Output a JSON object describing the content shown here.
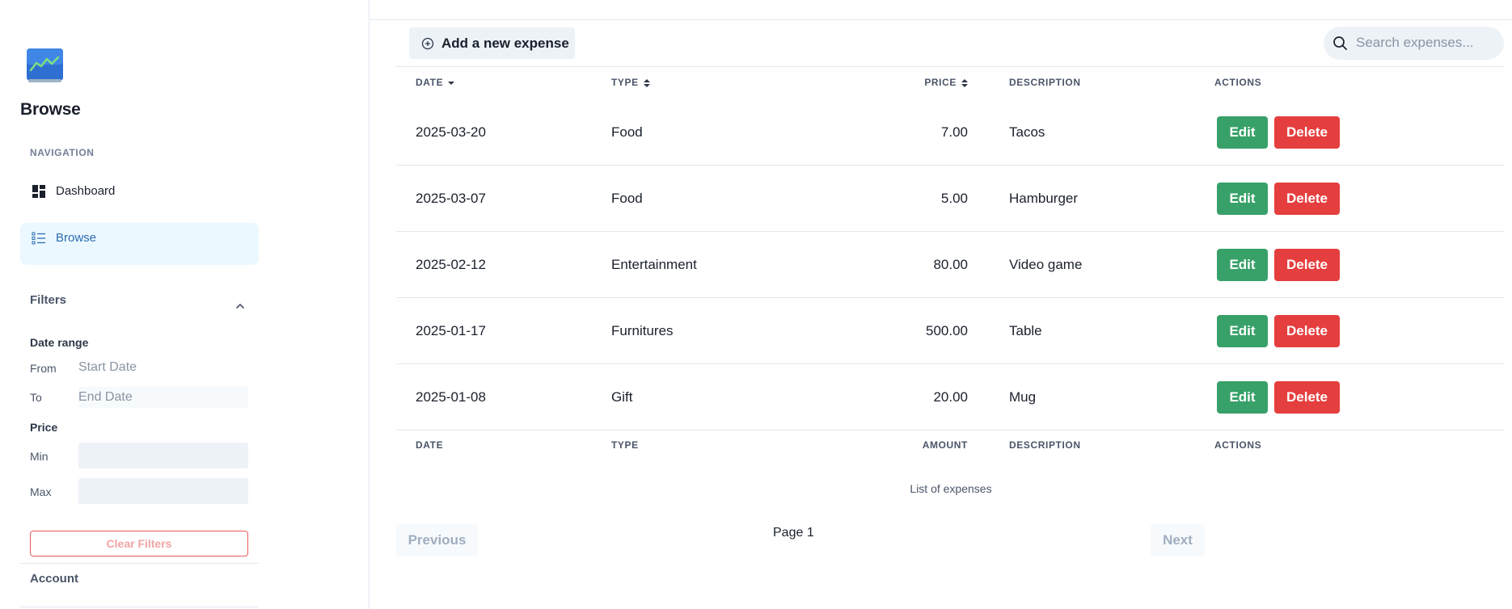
{
  "sidebar": {
    "title": "Browse",
    "nav_heading": "NAVIGATION",
    "nav_items": [
      {
        "label": "Dashboard",
        "icon": "dashboard-grid-icon",
        "active": false
      },
      {
        "label": "Browse",
        "icon": "list-icon",
        "active": true
      }
    ],
    "filters": {
      "heading": "Filters",
      "date_range_heading": "Date range",
      "from_label": "From",
      "from_placeholder": "Start Date",
      "to_label": "To",
      "to_placeholder": "End Date",
      "price_heading": "Price",
      "min_label": "Min",
      "max_label": "Max",
      "min_value": "",
      "max_value": "",
      "clear_label": "Clear Filters"
    },
    "account_heading": "Account"
  },
  "toolbar": {
    "add_label": "Add a new expense",
    "search_placeholder": "Search expenses..."
  },
  "table": {
    "header_top": [
      "DATE",
      "TYPE",
      "PRICE",
      "DESCRIPTION",
      "ACTIONS"
    ],
    "header_bottom": [
      "DATE",
      "TYPE",
      "AMOUNT",
      "DESCRIPTION",
      "ACTIONS"
    ],
    "sort": {
      "date": "descending",
      "type": "unsorted",
      "price": "unsorted"
    },
    "rows": [
      {
        "date": "2025-03-20",
        "type": "Food",
        "price": "7.00",
        "description": "Tacos",
        "edit": "Edit",
        "delete": "Delete"
      },
      {
        "date": "2025-03-07",
        "type": "Food",
        "price": "5.00",
        "description": "Hamburger",
        "edit": "Edit",
        "delete": "Delete"
      },
      {
        "date": "2025-02-12",
        "type": "Entertainment",
        "price": "80.00",
        "description": "Video game",
        "edit": "Edit",
        "delete": "Delete"
      },
      {
        "date": "2025-01-17",
        "type": "Furnitures",
        "price": "500.00",
        "description": "Table",
        "edit": "Edit",
        "delete": "Delete"
      },
      {
        "date": "2025-01-08",
        "type": "Gift",
        "price": "20.00",
        "description": "Mug",
        "edit": "Edit",
        "delete": "Delete"
      }
    ],
    "caption": "List of expenses"
  },
  "pagination": {
    "previous_label": "Previous",
    "page_label": "Page 1",
    "next_label": "Next"
  },
  "colors": {
    "edit_button": "#38a169",
    "delete_button": "#e53e3e",
    "active_nav_bg": "#ebf8ff",
    "active_nav_text": "#2b6cb0"
  }
}
